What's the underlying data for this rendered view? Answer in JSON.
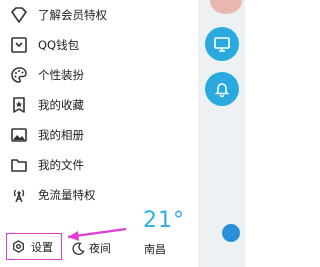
{
  "menu": {
    "items": [
      {
        "label": "了解会员特权",
        "icon": "vip-icon"
      },
      {
        "label": "QQ钱包",
        "icon": "wallet-icon"
      },
      {
        "label": "个性装扮",
        "icon": "palette-icon"
      },
      {
        "label": "我的收藏",
        "icon": "bookmark-star-icon"
      },
      {
        "label": "我的相册",
        "icon": "image-icon"
      },
      {
        "label": "我的文件",
        "icon": "folder-icon"
      },
      {
        "label": "免流量特权",
        "icon": "signal-tower-icon"
      }
    ]
  },
  "bottom": {
    "settings_label": "设置",
    "night_label": "夜间"
  },
  "weather": {
    "temperature": "21°",
    "city": "南昌"
  },
  "colors": {
    "accent_blue": "#29a9de",
    "highlight_magenta": "#e23dd1"
  }
}
